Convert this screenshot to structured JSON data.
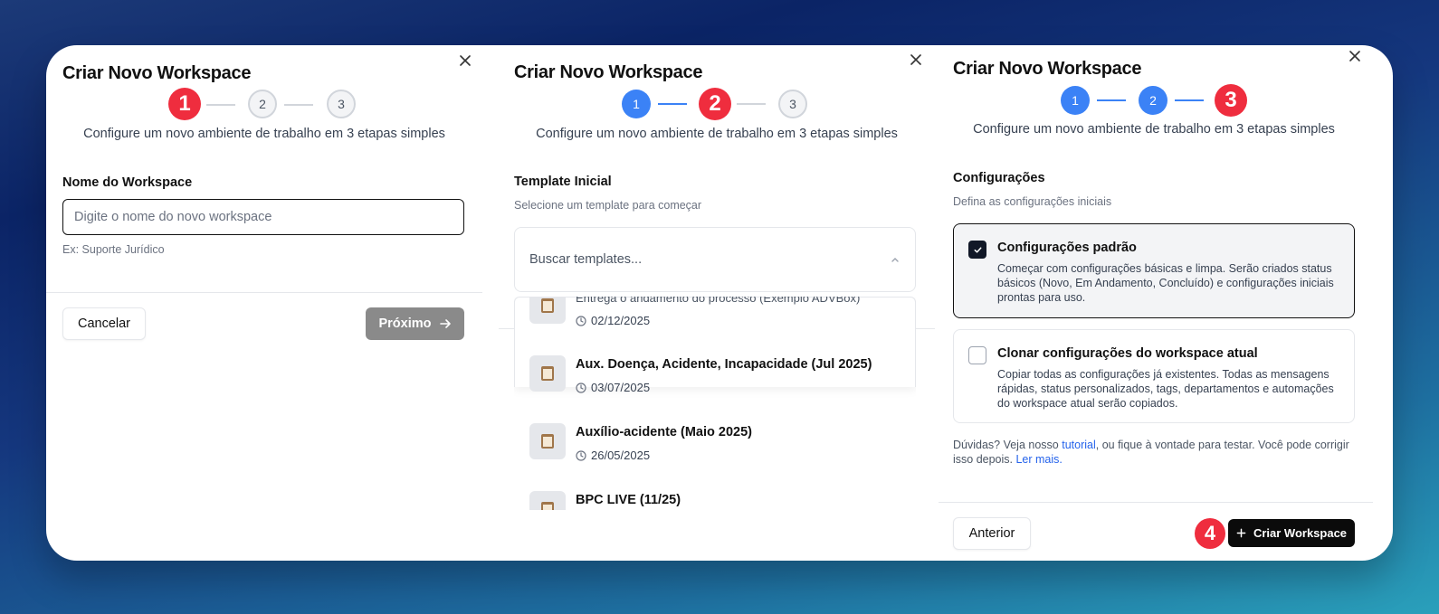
{
  "step1": {
    "title": "Criar Novo Workspace",
    "steps": [
      "1",
      "2",
      "3"
    ],
    "subtitle": "Configure um novo ambiente de trabalho em 3 etapas simples",
    "name_label": "Nome do Workspace",
    "name_placeholder": "Digite o nome do novo workspace",
    "name_value": "",
    "name_hint": "Ex: Suporte Jurídico",
    "cancel_label": "Cancelar",
    "next_label": "Próximo"
  },
  "step2": {
    "title": "Criar Novo Workspace",
    "steps": [
      "1",
      "2",
      "3"
    ],
    "subtitle": "Configure um novo ambiente de trabalho em 3 etapas simples",
    "template_label": "Template Inicial",
    "template_hint": "Selecione um template para começar",
    "search_placeholder": "Buscar templates...",
    "templates": [
      {
        "name": "",
        "desc": "Entrega o andamento do processo (Exemplo ADVBox)",
        "date": "02/12/2025"
      },
      {
        "name": "Aux. Doença, Acidente, Incapacidade (Jul 2025)",
        "desc": "",
        "date": "03/07/2025"
      },
      {
        "name": "Auxílio-acidente (Maio 2025)",
        "desc": "",
        "date": "26/05/2025"
      },
      {
        "name": "BPC LIVE (11/25)",
        "desc": "",
        "date": ""
      }
    ]
  },
  "step3": {
    "title": "Criar Novo Workspace",
    "steps": [
      "1",
      "2",
      "3"
    ],
    "subtitle": "Configure um novo ambiente de trabalho em 3 etapas simples",
    "config_label": "Configurações",
    "config_hint": "Defina as configurações iniciais",
    "options": [
      {
        "title": "Configurações padrão",
        "desc": "Começar com configurações básicas e limpa. Serão criados status básicos (Novo, Em Andamento, Concluído) e configurações iniciais prontas para uso.",
        "checked": true
      },
      {
        "title": "Clonar configurações do workspace atual",
        "desc": "Copiar todas as configurações já existentes. Todas as mensagens rápidas, status personalizados, tags, departamentos e automações do workspace atual serão copiados.",
        "checked": false
      }
    ],
    "help_prefix": "Dúvidas? Veja nosso ",
    "help_link1": "tutorial",
    "help_middle": ", ou fique à vontade para testar. Você pode corrigir isso depois. ",
    "help_link2": "Ler mais.",
    "back_label": "Anterior",
    "create_label": "Criar Workspace",
    "annotation": "4"
  },
  "colors": {
    "accent_blue": "#3b82f6",
    "annotation_red": "#ef2d3e",
    "primary_dark": "#0b0b0b",
    "disabled_gray": "#8a8a8a"
  },
  "icons": [
    "close-icon",
    "arrow-right-icon",
    "chevron-up-icon",
    "clock-icon",
    "calendar-icon",
    "check-icon",
    "plus-icon"
  ]
}
